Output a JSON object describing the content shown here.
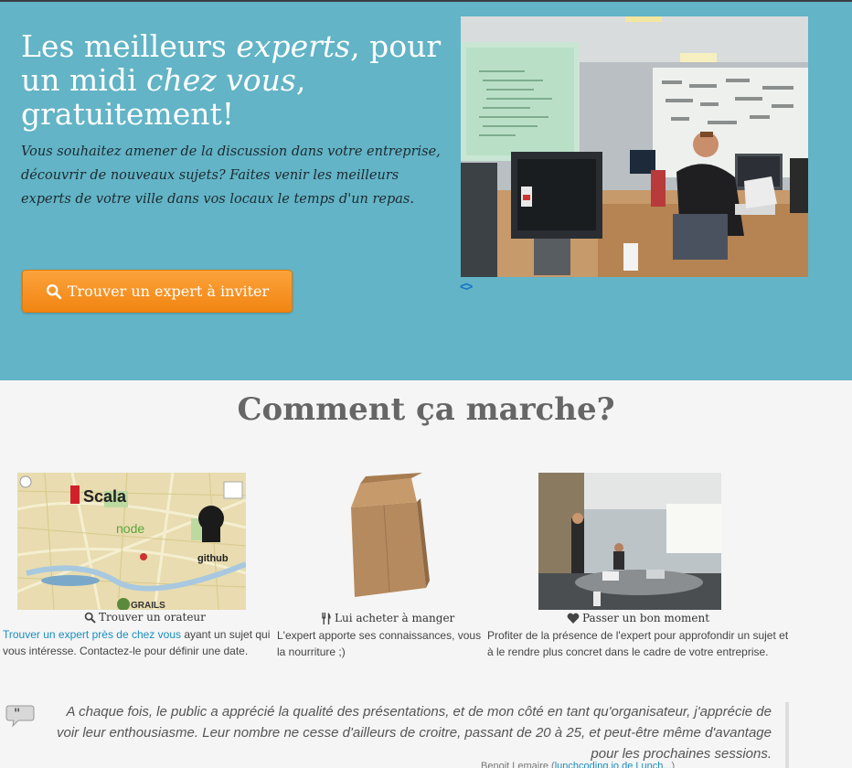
{
  "hero": {
    "title_part1": "Les meilleurs ",
    "title_em1": "experts",
    "title_part2": ", pour un midi ",
    "title_em2": "chez vous",
    "title_part3": ", gratuitement!",
    "lead": "Vous souhaitez amener de la discussion dans votre entreprise, découvrir de nouveaux sujets? Faites venir les meilleurs experts de votre ville dans vos locaux le temps d'un repas.",
    "cta_label": "Trouver un expert à inviter",
    "carousel_control": "<>"
  },
  "how": {
    "title": "Comment ça marche?",
    "steps": [
      {
        "heading": "Trouver un orateur",
        "link": "Trouver un expert près de chez vous",
        "text": " ayant un sujet qui vous intéresse. Contactez-le pour définir une date.",
        "image_labels": {
          "scala": "Scala",
          "node": "node",
          "github": "github",
          "grails": "GRAILS"
        }
      },
      {
        "heading": "Lui acheter à manger",
        "text": "L'expert apporte ses connaissances, vous la nourriture ;)"
      },
      {
        "heading": "Passer un bon moment",
        "text": "Profiter de la présence de l'expert pour approfondir un sujet et à le rendre plus concret dans le cadre de votre entreprise."
      }
    ]
  },
  "testimonial": {
    "quote": "A chaque fois, le public a apprécié la qualité des présentations, et de mon côté en tant qu'organisateur, j'apprécie de voir leur enthousiasme. Leur nombre ne cesse d'ailleurs de croitre, passant de 20 à 25, et peut-être même d'avantage pour les prochaines sessions.",
    "source_prefix": "Benoit Lemaire (",
    "source_link": "lunchcoding.io de Lunch...",
    "source_suffix": ")"
  },
  "colors": {
    "hero_bg": "#62b4c6",
    "cta": "#f28512",
    "link": "#1a8dbf"
  }
}
